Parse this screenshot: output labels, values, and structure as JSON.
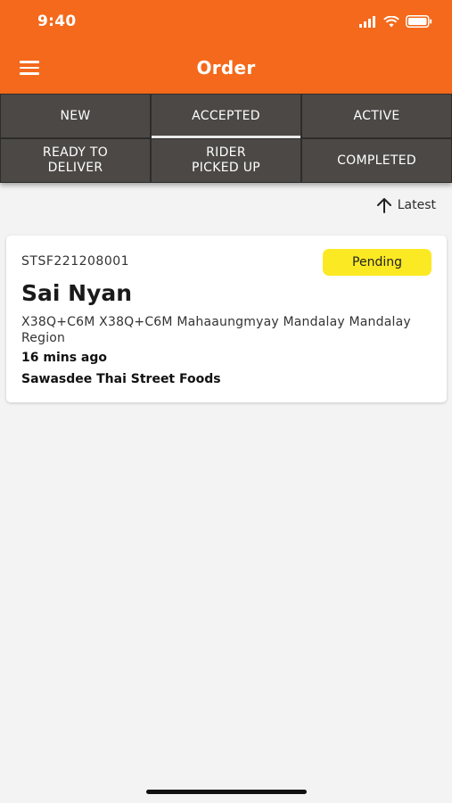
{
  "status_bar": {
    "time": "9:40"
  },
  "header": {
    "title": "Order",
    "menu_icon": "menu-icon"
  },
  "tabs": [
    {
      "label": "NEW"
    },
    {
      "label": "ACCEPTED",
      "selected": true
    },
    {
      "label": "ACTIVE"
    },
    {
      "label": "READY TO\nDELIVER"
    },
    {
      "label": "RIDER\nPICKED UP"
    },
    {
      "label": "COMPLETED"
    }
  ],
  "sort": {
    "label": "Latest",
    "icon": "arrow-up-icon"
  },
  "orders": [
    {
      "id": "STSF221208001",
      "status": "Pending",
      "customer": "Sai Nyan",
      "address": "X38Q+C6M X38Q+C6M  Mahaaungmyay Mandalay Mandalay Region",
      "time_ago": "16 mins ago",
      "shop": "Sawasdee Thai Street Foods"
    }
  ],
  "colors": {
    "header_bg": "#f4691b",
    "tab_bg": "#4b4846",
    "badge_bg": "#fbe923",
    "page_bg": "#f3f3f3"
  }
}
